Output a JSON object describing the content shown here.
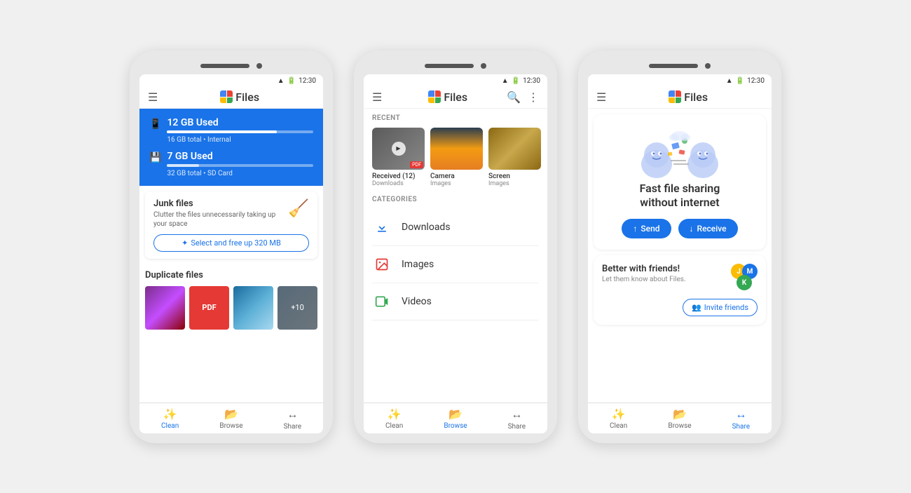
{
  "app": {
    "name": "Files",
    "time": "12:30"
  },
  "phone1": {
    "storage": {
      "internal": {
        "title": "12 GB Used",
        "detail": "16 GB total • Internal",
        "fill_percent": 75
      },
      "sd": {
        "title": "7 GB Used",
        "detail": "32 GB total • SD Card",
        "fill_percent": 22
      }
    },
    "junk": {
      "title": "Junk files",
      "description": "Clutter the files unnecessarily taking up your space",
      "button": "Select and free up 320 MB"
    },
    "duplicate": {
      "title": "Duplicate files",
      "more_label": "+10"
    },
    "nav": {
      "items": [
        {
          "label": "Clean",
          "active": true
        },
        {
          "label": "Browse",
          "active": false
        },
        {
          "label": "Share",
          "active": false
        }
      ]
    }
  },
  "phone2": {
    "recent_label": "RECENT",
    "categories_label": "CATEGORIES",
    "recent_items": [
      {
        "name": "Received (12)",
        "sub": "Downloads"
      },
      {
        "name": "Camera",
        "sub": "Images"
      },
      {
        "name": "Screen",
        "sub": "Images"
      }
    ],
    "categories": [
      {
        "name": "Downloads"
      },
      {
        "name": "Images"
      },
      {
        "name": "Videos"
      }
    ],
    "nav": {
      "items": [
        {
          "label": "Clean",
          "active": false
        },
        {
          "label": "Browse",
          "active": true
        },
        {
          "label": "Share",
          "active": false
        }
      ]
    }
  },
  "phone3": {
    "hero": {
      "title": "Fast file sharing\nwithout internet",
      "send_label": "Send",
      "receive_label": "Receive"
    },
    "friends": {
      "title": "Better with friends!",
      "description": "Let them know about Files.",
      "invite_label": "Invite friends"
    },
    "nav": {
      "items": [
        {
          "label": "Clean",
          "active": false
        },
        {
          "label": "Browse",
          "active": false
        },
        {
          "label": "Share",
          "active": true
        }
      ]
    }
  },
  "icons": {
    "menu": "☰",
    "search": "🔍",
    "more": "⋮",
    "clean": "✨",
    "browse": "📂",
    "share": "↔",
    "send_arrow": "↑",
    "receive_arrow": "↓",
    "phone": "📱",
    "sd_card": "💾",
    "add_person": "👤+",
    "downloads_icon": "⬇",
    "images_icon": "🖼",
    "videos_icon": "🎬"
  }
}
